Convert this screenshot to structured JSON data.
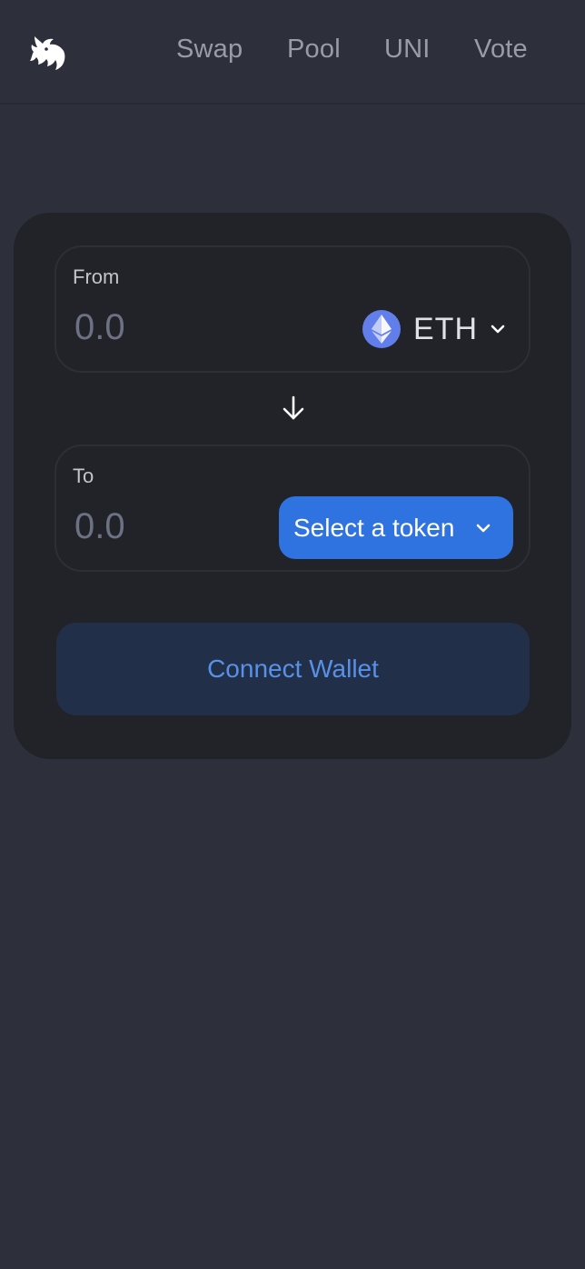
{
  "header": {
    "logo_icon": "uniswap-unicorn-icon",
    "nav": [
      "Swap",
      "Pool",
      "UNI",
      "Vote"
    ]
  },
  "swap": {
    "from": {
      "label": "From",
      "amount_placeholder": "0.0",
      "token": "ETH",
      "token_icon": "eth-icon"
    },
    "arrow_icon": "arrow-down-icon",
    "to": {
      "label": "To",
      "amount_placeholder": "0.0",
      "select_label": "Select a token"
    },
    "connect_label": "Connect Wallet"
  },
  "colors": {
    "background": "#2d303b",
    "card": "#212328",
    "accent": "#2f73e0",
    "connect_bg": "#213048",
    "connect_text": "#5990e8"
  }
}
